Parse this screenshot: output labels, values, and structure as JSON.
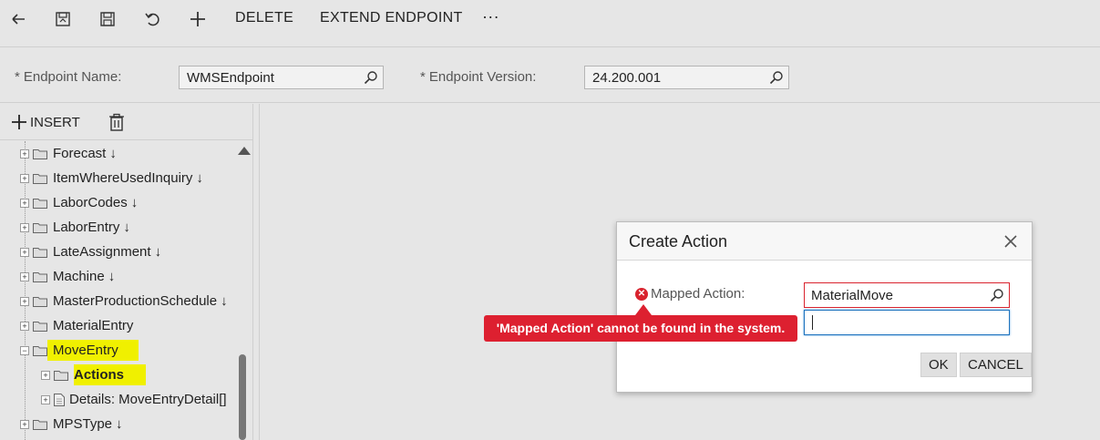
{
  "toolbar": {
    "icons": [
      "back-icon",
      "save-and-close-icon",
      "save-icon",
      "undo-icon",
      "add-icon"
    ],
    "delete_label": "DELETE",
    "extend_label": "EXTEND ENDPOINT",
    "more_label": "···"
  },
  "form": {
    "endpoint_name_label": "Endpoint Name:",
    "endpoint_name_value": "WMSEndpoint",
    "endpoint_version_label": "Endpoint Version:",
    "endpoint_version_value": "24.200.001",
    "required_marker": "*"
  },
  "left_panel": {
    "insert_label": "INSERT",
    "tree": [
      {
        "label": "Forecast",
        "arrow": "↓"
      },
      {
        "label": "ItemWhereUsedInquiry",
        "arrow": "↓"
      },
      {
        "label": "LaborCodes",
        "arrow": "↓"
      },
      {
        "label": "LaborEntry",
        "arrow": "↓"
      },
      {
        "label": "LateAssignment",
        "arrow": "↓"
      },
      {
        "label": "Machine",
        "arrow": "↓"
      },
      {
        "label": "MasterProductionSchedule",
        "arrow": "↓"
      },
      {
        "label": "MaterialEntry",
        "arrow": ""
      },
      {
        "label": "MoveEntry",
        "arrow": ""
      },
      {
        "label": "Actions",
        "arrow": ""
      },
      {
        "label": "Details: MoveEntryDetail[]",
        "arrow": ""
      },
      {
        "label": "MPSType",
        "arrow": "↓"
      }
    ]
  },
  "dialog": {
    "title": "Create Action",
    "mapped_action_label": "Mapped Action:",
    "mapped_action_value": "MaterialMove",
    "ok_label": "OK",
    "cancel_label": "CANCEL",
    "error_message": "'Mapped Action' cannot be found in the system."
  },
  "colors": {
    "highlight": "#f0f000",
    "error": "#dd2030",
    "focus": "#1e73be"
  }
}
